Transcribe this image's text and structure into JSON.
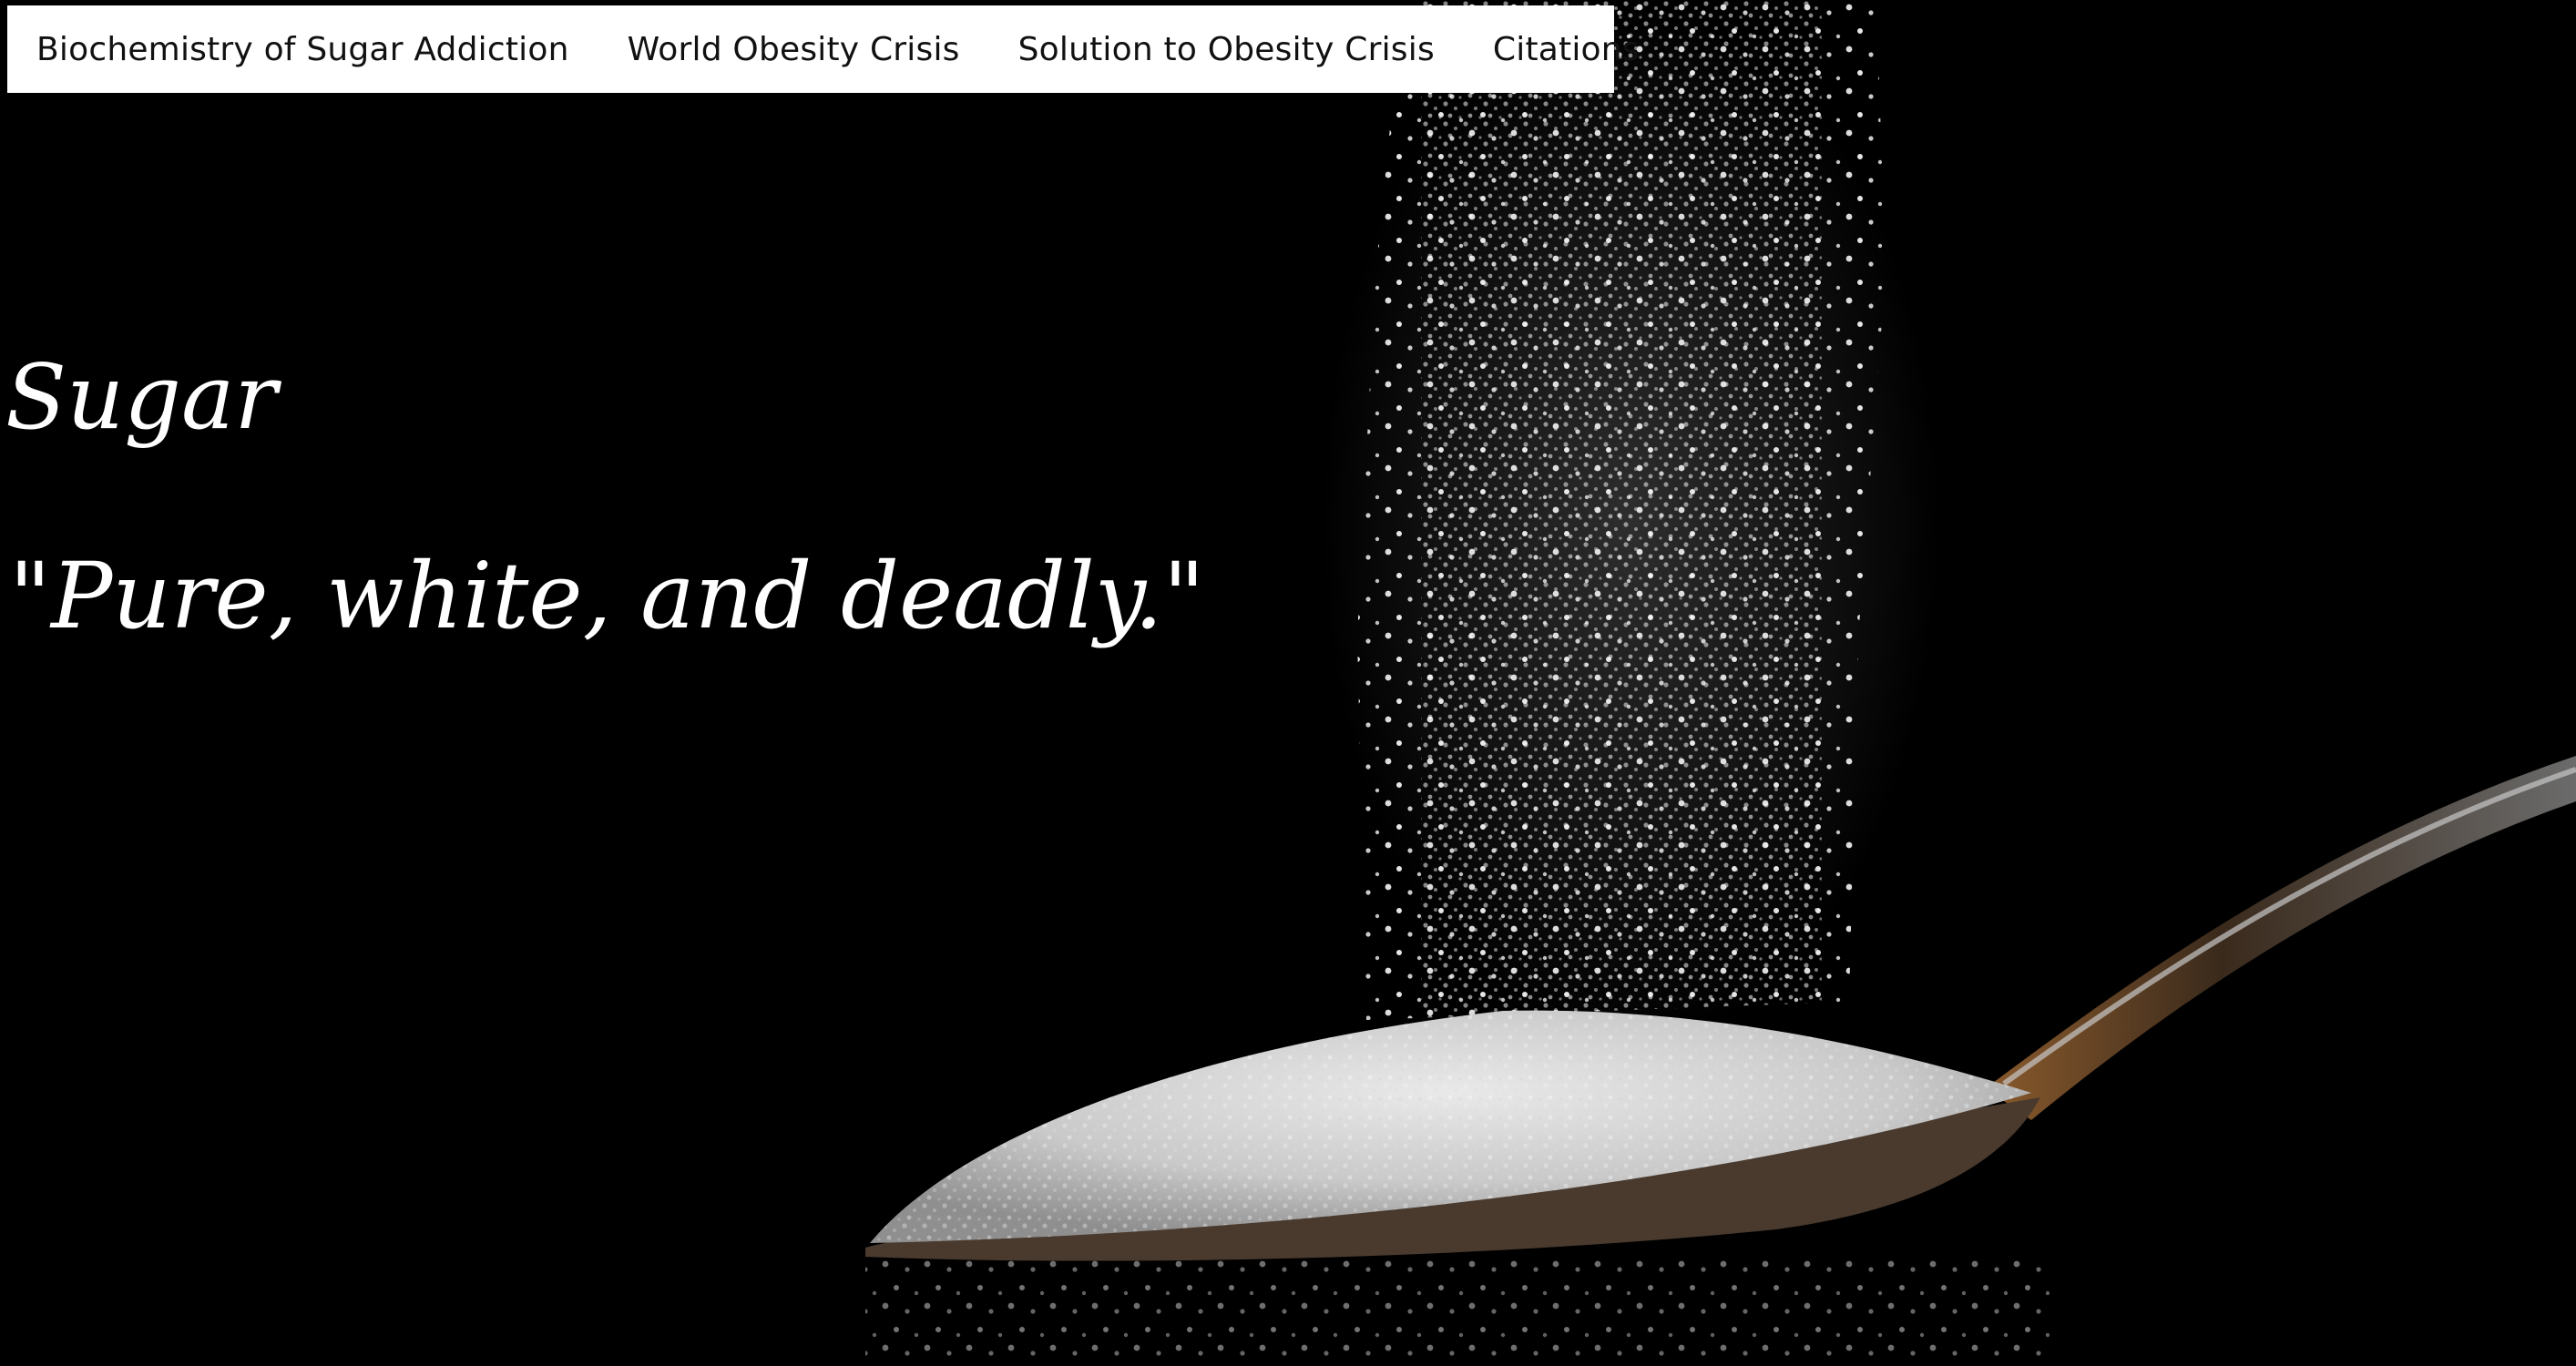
{
  "nav": {
    "items": [
      {
        "label": "Biochemistry of Sugar Addiction"
      },
      {
        "label": "World Obesity Crisis"
      },
      {
        "label": "Solution to Obesity Crisis"
      },
      {
        "label": "Citations"
      }
    ]
  },
  "hero": {
    "title": "Sugar",
    "quote": "\"Pure, white, and deadly.\"",
    "image_icon": "sugar-spoon-image"
  },
  "colors": {
    "background": "#000000",
    "nav_background": "#ffffff",
    "nav_text": "#111111",
    "hero_text": "#ffffff"
  }
}
